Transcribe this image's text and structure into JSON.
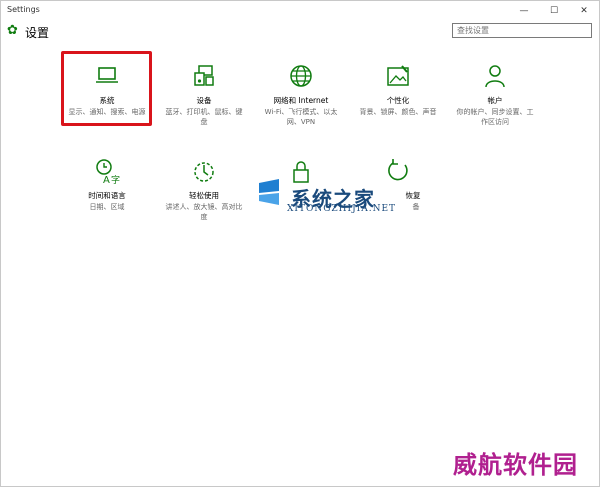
{
  "window": {
    "title": "Settings",
    "controls": {
      "minimize": "—",
      "maximize": "☐",
      "close": "✕"
    }
  },
  "header": {
    "title": "设置",
    "search": {
      "placeholder": "查找设置",
      "value": ""
    }
  },
  "tiles": [
    {
      "icon": "laptop-icon",
      "name": "系统",
      "desc": "显示、通知、搜索、电源"
    },
    {
      "icon": "devices-icon",
      "name": "设备",
      "desc": "蓝牙、打印机、鼠标、键盘"
    },
    {
      "icon": "globe-icon",
      "name": "网络和 Internet",
      "desc": "Wi-Fi、飞行模式、以太网、VPN"
    },
    {
      "icon": "personalization-icon",
      "name": "个性化",
      "desc": "背景、锁屏、颜色、声音"
    },
    {
      "icon": "person-icon",
      "name": "帐户",
      "desc": "你的帐户、同步设置、工作区访问"
    },
    {
      "icon": "time-language-icon",
      "name": "时间和语言",
      "desc": "日期、区域"
    },
    {
      "icon": "ease-of-access-icon",
      "name": "轻松使用",
      "desc": "讲述人、放大镜、高对比度"
    },
    {
      "icon": "lock-icon",
      "name": "",
      "desc": ""
    },
    {
      "icon": "recovery-icon",
      "name": "恢复",
      "desc": "备"
    }
  ],
  "watermarks": {
    "site_name": "系统之家",
    "site_url": "XITONGZHIJIA.NET",
    "corner": "威航软件园"
  },
  "colors": {
    "accent": "#107c10",
    "highlight": "#d9141b",
    "watermark_blue": "#1a4a7c",
    "watermark_purple": "#b0208f"
  }
}
